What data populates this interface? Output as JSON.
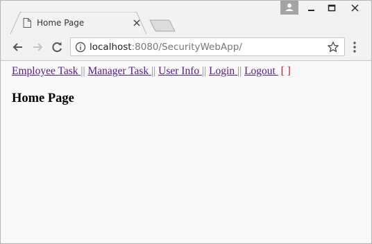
{
  "browser": {
    "tab": {
      "title": "Home Page",
      "favicon": "document-icon"
    },
    "window_controls": [
      "user-icon",
      "minimize-icon",
      "maximize-icon",
      "close-icon"
    ],
    "address_bar": {
      "host": "localhost",
      "rest": ":8080/SecurityWebApp/"
    }
  },
  "page": {
    "nav": {
      "employee_task": "Employee Task ",
      "manager_task": "Manager Task ",
      "user_info": "User Info ",
      "login": "Login ",
      "logout": "Logout ",
      "separator": "||",
      "user_bracket": "[ ]"
    },
    "heading": "Home Page"
  },
  "colors": {
    "link": "#551a8b",
    "bracket": "#dd1111",
    "chrome": "#f2f2f2",
    "page_bg": "#f8f8f8"
  }
}
